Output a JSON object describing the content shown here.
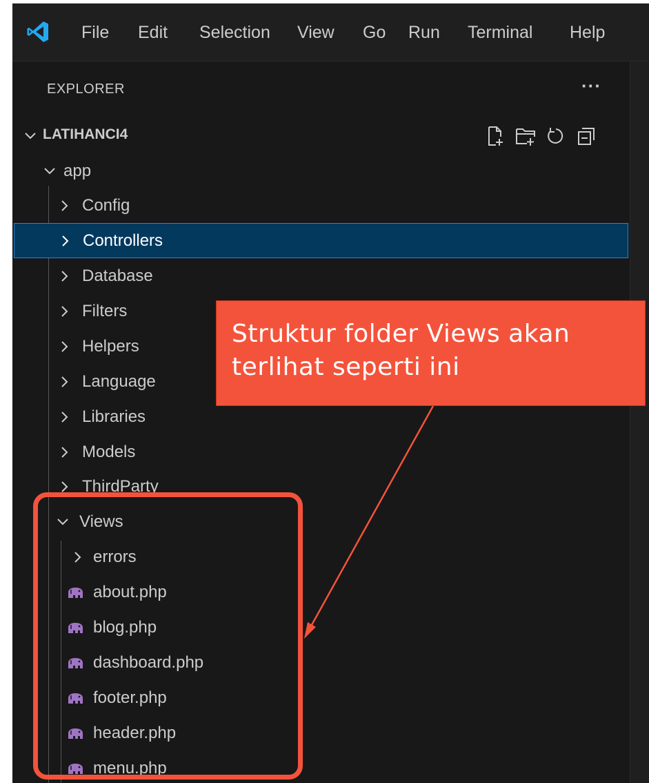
{
  "menu": {
    "items": [
      "File",
      "Edit",
      "Selection",
      "View",
      "Go",
      "Run",
      "Terminal",
      "Help"
    ]
  },
  "explorer": {
    "title": "EXPLORER",
    "more": "···",
    "root": {
      "label": "LATIHANCI4",
      "actions": [
        "new-file-icon",
        "new-folder-icon",
        "refresh-icon",
        "collapse-all-icon"
      ]
    },
    "app": {
      "label": "app"
    },
    "folders": [
      "Config",
      "Controllers",
      "Database",
      "Filters",
      "Helpers",
      "Language",
      "Libraries",
      "Models",
      "ThirdParty"
    ],
    "selected_folder": "Controllers",
    "views": {
      "label": "Views",
      "subfolder": "errors",
      "files": [
        "about.php",
        "blog.php",
        "dashboard.php",
        "footer.php",
        "header.php",
        "menu.php"
      ]
    }
  },
  "annotation": {
    "line1": "Struktur folder Views akan",
    "line2": "terlihat seperti ini"
  },
  "colors": {
    "sidebar_bg": "#181818",
    "selection_bg": "#04395e",
    "selection_border": "#2b84d0",
    "annotation": "#f4533b",
    "php_icon": "#a074c4",
    "vscode_blue": "#23a9f2"
  }
}
